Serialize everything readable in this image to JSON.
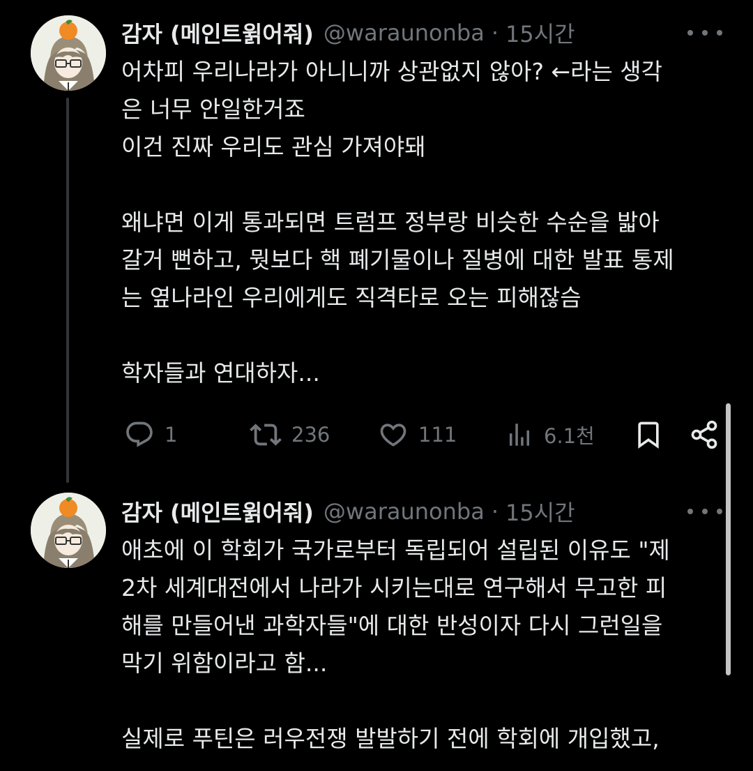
{
  "tweets": [
    {
      "name": "감자 (메인트윍어줘)",
      "handle": "@waraunonba",
      "dot": "·",
      "time": "15시간",
      "text": "어차피 우리나라가 아니니까 상관없지 않아? ←라는 생각\n은 너무 안일한거죠\n이건 진짜 우리도 관심 가져야돼\n\n왜냐면 이게 통과되면 트럼프 정부랑 비슷한 수순을 밟아\n갈거 뻔하고, 뭣보다 핵 폐기물이나 질병에 대한 발표 통제\n는 옆나라인 우리에게도 직격타로 오는 피해잖슴\n\n학자들과 연대하자...",
      "actions": {
        "reply_count": "1",
        "retweet_count": "236",
        "like_count": "111",
        "views_count": "6.1천"
      }
    },
    {
      "name": "감자 (메인트윍어줘)",
      "handle": "@waraunonba",
      "dot": "·",
      "time": "15시간",
      "text": "애초에 이 학회가 국가로부터 독립되어 설립된 이유도 \"제\n2차 세계대전에서 나라가 시키는대로 연구해서 무고한 피\n해를 만들어낸 과학자들\"에 대한 반성이자 다시 그런일을\n막기 위함이라고 함...\n\n실제로 푸틴은 러우전쟁 발발하기 전에 학회에 개입했고,"
    }
  ],
  "icons": {
    "reply": "reply-icon",
    "retweet": "retweet-icon",
    "like": "heart-icon",
    "views": "views-icon",
    "bookmark": "bookmark-icon",
    "share": "share-icon",
    "more": "more-icon"
  },
  "colors": {
    "background": "#000000",
    "text": "#e7e9ea",
    "secondary": "#71767b",
    "thread_line": "#333639"
  }
}
